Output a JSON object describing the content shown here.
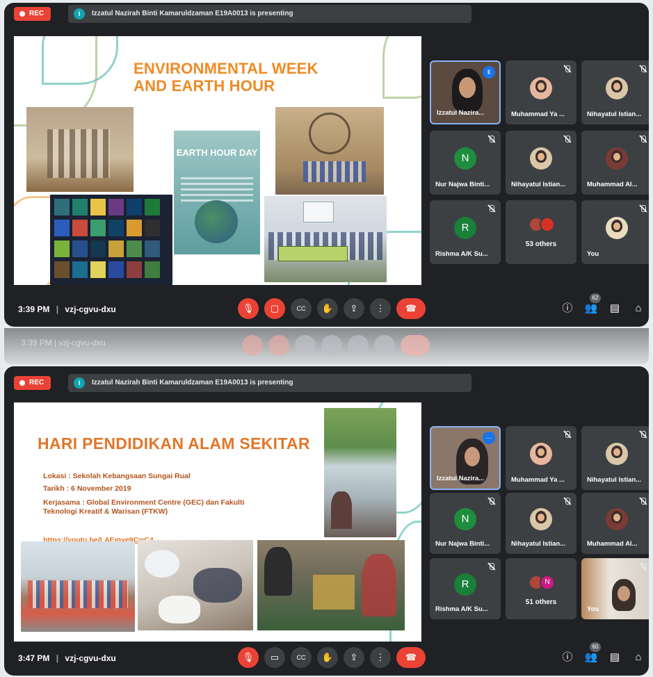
{
  "shots": [
    {
      "rec_label": "REC",
      "presenter_initial": "I",
      "presenting_text": "Izzatul Nazirah Binti Kamaruldzaman E19A0013 is presenting",
      "slide_title": "ENVIRONMENTAL WEEK AND EARTH HOUR",
      "slide_title_line1": "ENVIRONMENTAL WEEK",
      "slide_title_line2": "AND EARTH HOUR",
      "poster_title": "EARTH HOUR DAY",
      "tiles": [
        {
          "name": "Izzatul Nazira..."
        },
        {
          "name": "Muhammad Ya ..."
        },
        {
          "name": "Nihayatul Istian..."
        },
        {
          "name": "Nur Najwa Binti...",
          "initial": "N",
          "color": "#1e8e3e"
        },
        {
          "name": "Nihayatul Istian..."
        },
        {
          "name": "Muhammad Al..."
        },
        {
          "name": "Rishma A/K Su...",
          "initial": "R",
          "color": "#188038"
        },
        {
          "name": "53 others"
        },
        {
          "name": "You"
        }
      ],
      "time": "3:39 PM",
      "code": "vzj-cgvu-dxu",
      "people_count": "62"
    },
    {
      "rec_label": "REC",
      "presenter_initial": "I",
      "presenting_text": "Izzatul Nazirah Binti Kamaruldzaman E19A0013 is presenting",
      "slide_title": "HARI PENDIDIKAN ALAM SEKITAR",
      "lokasi": "Lokasi : Sekolah Kebangsaan Sungai Rual",
      "tarikh": "Tarikh : 6 November 2019",
      "kerjasama_line1": "Kerjasama : Global Environment Centre (GEC) dan Fakulti",
      "kerjasama_line2": "Teknologi Kreatif & Warisan (FTKW)",
      "link": "https://youtu.be/LAEmye9CwC4",
      "tiles": [
        {
          "name": "Izzatul Nazira..."
        },
        {
          "name": "Muhammad Ya ..."
        },
        {
          "name": "Nihayatul Istian..."
        },
        {
          "name": "Nur Najwa Binti...",
          "initial": "N",
          "color": "#1e8e3e"
        },
        {
          "name": "Nihayatul Istian..."
        },
        {
          "name": "Muhammad Al..."
        },
        {
          "name": "Rishma A/K Su...",
          "initial": "R",
          "color": "#188038"
        },
        {
          "name": "51 others",
          "initial": "N"
        },
        {
          "name": "You"
        }
      ],
      "time": "3:47 PM",
      "code": "vzj-cgvu-dxu",
      "people_count": "60"
    }
  ],
  "ghost_time": "3:39 PM | vzj-cgvu-dxu",
  "icons": [
    "mic-off-icon",
    "camera-off-icon",
    "captions-icon",
    "raise-hand-icon",
    "present-icon",
    "more-icon",
    "end-call-icon",
    "info-icon",
    "people-icon",
    "chat-icon",
    "activities-icon"
  ]
}
